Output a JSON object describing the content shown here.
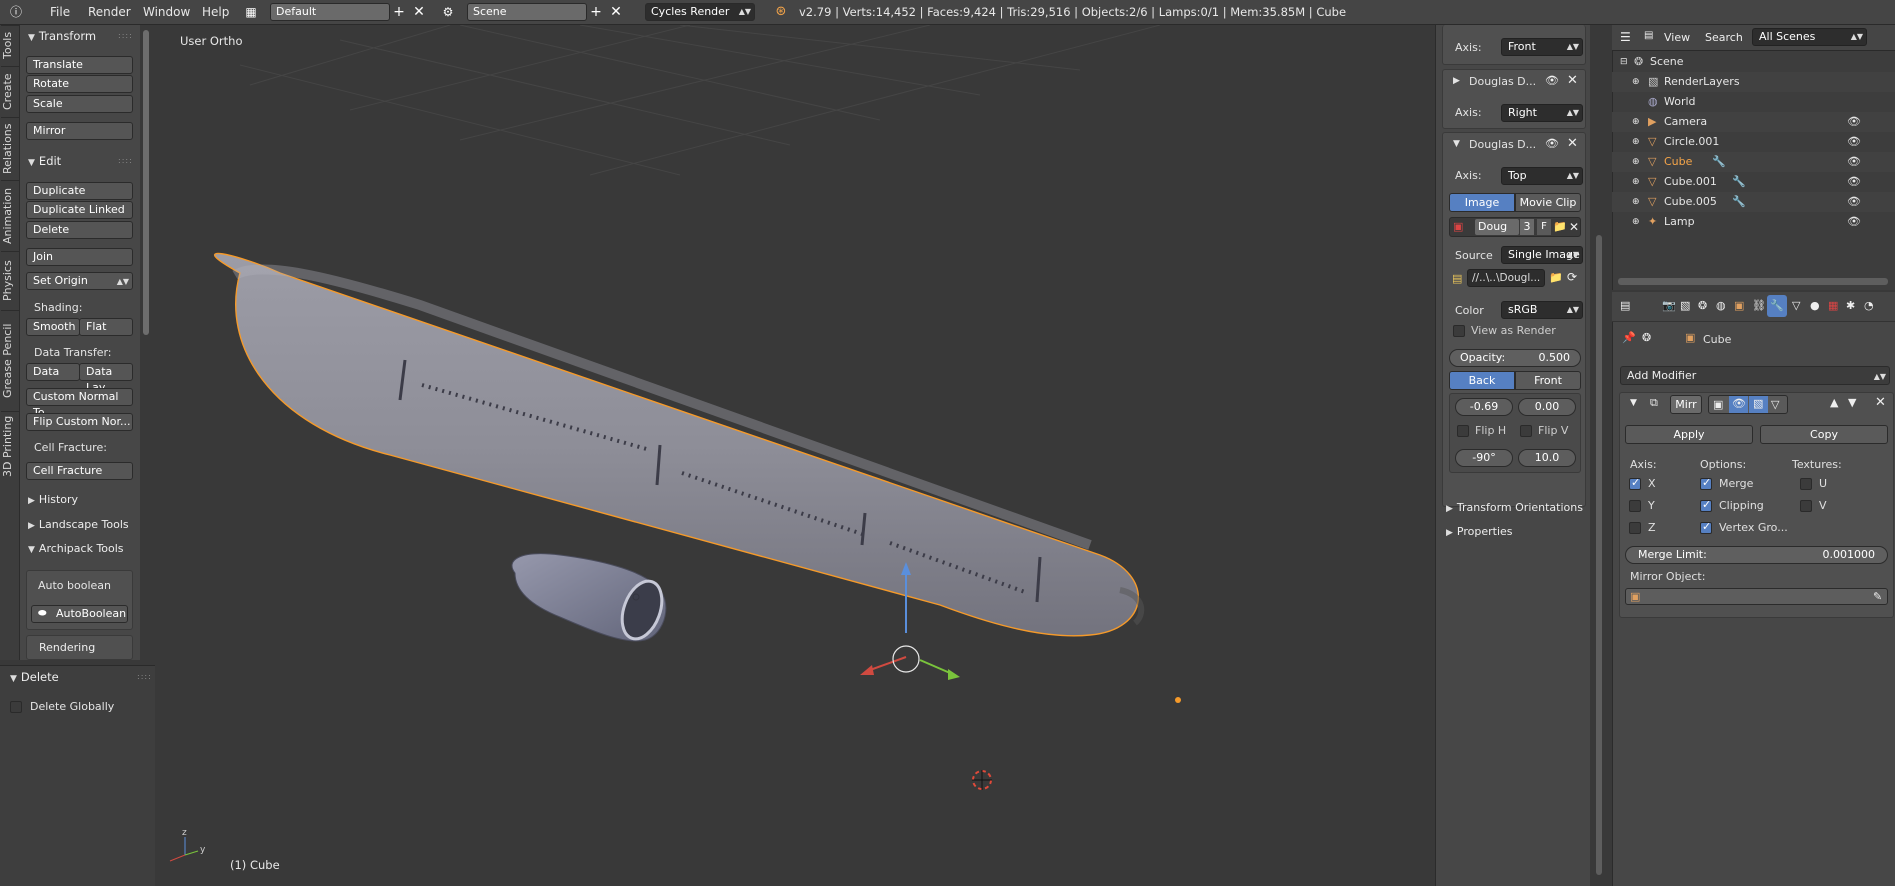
{
  "topbar": {
    "menus": [
      "File",
      "Render",
      "Window",
      "Help"
    ],
    "screen_layout": "Default",
    "scene": "Scene",
    "render_engine": "Cycles Render",
    "stats": "v2.79 | Verts:14,452 | Faces:9,424 | Tris:29,516 | Objects:2/6 | Lamps:0/1 | Mem:35.85M | Cube"
  },
  "tool_tabs": [
    "Tools",
    "Create",
    "Relations",
    "Animation",
    "Physics",
    "Grease Pencil",
    "3D Printing"
  ],
  "toolshelf": {
    "transform_title": "Transform",
    "translate": "Translate",
    "rotate": "Rotate",
    "scale": "Scale",
    "mirror": "Mirror",
    "edit_title": "Edit",
    "duplicate": "Duplicate",
    "duplicate_linked": "Duplicate Linked",
    "delete": "Delete",
    "join": "Join",
    "set_origin": "Set Origin",
    "shading_label": "Shading:",
    "smooth": "Smooth",
    "flat": "Flat",
    "data_transfer_label": "Data Transfer:",
    "data": "Data",
    "data_lay": "Data Lay",
    "custom_normal": "Custom Normal To",
    "flip_custom": "Flip Custom Nor...",
    "cell_fracture_label": "Cell Fracture:",
    "cell_fracture": "Cell Fracture",
    "history": "History",
    "landscape": "Landscape Tools",
    "archipack": "Archipack Tools",
    "auto_boolean_label": "Auto boolean",
    "auto_boolean_btn": "AutoBoolean",
    "rendering": "Rendering"
  },
  "operator_panel": {
    "title": "Delete",
    "delete_globally": "Delete Globally"
  },
  "viewport": {
    "view_label": "User Ortho",
    "object_label": "(1) Cube"
  },
  "npanel": {
    "axis_label": "Axis:",
    "img1_axis": "Front",
    "img2_name": "Douglas D...",
    "img2_axis": "Right",
    "img3_name": "Douglas D...",
    "img3_axis": "Top",
    "image_tab": "Image",
    "movie_tab": "Movie Clip",
    "image_name": "Doug",
    "users": "3",
    "fake_user": "F",
    "source_label": "Source",
    "source_value": "Single Image",
    "filepath": "//..\\..\\Dougl...",
    "color_label": "Color",
    "color_value": "sRGB",
    "view_as_render": "View as Render",
    "opacity_label": "Opacity:",
    "opacity_value": "0.500",
    "back": "Back",
    "front": "Front",
    "offset_x": "-0.69",
    "offset_y": "0.00",
    "flip_h": "Flip H",
    "flip_v": "Flip V",
    "rotation": "-90°",
    "size": "10.0",
    "transform_orientations": "Transform Orientations",
    "properties": "Properties"
  },
  "outliner": {
    "view": "View",
    "search": "Search",
    "filter": "All Scenes",
    "items": [
      {
        "name": "Scene"
      },
      {
        "name": "RenderLayers"
      },
      {
        "name": "World"
      },
      {
        "name": "Camera"
      },
      {
        "name": "Circle.001"
      },
      {
        "name": "Cube"
      },
      {
        "name": "Cube.001"
      },
      {
        "name": "Cube.005"
      },
      {
        "name": "Lamp"
      }
    ]
  },
  "properties": {
    "object_name": "Cube",
    "add_modifier": "Add Modifier",
    "modifier_name": "Mirr",
    "apply": "Apply",
    "copy": "Copy",
    "axis_label": "Axis:",
    "options_label": "Options:",
    "textures_label": "Textures:",
    "x": "X",
    "y": "Y",
    "z": "Z",
    "merge": "Merge",
    "clipping": "Clipping",
    "vertex_groups": "Vertex Gro...",
    "u": "U",
    "v": "V",
    "merge_limit_label": "Merge Limit:",
    "merge_limit_value": "0.001000",
    "mirror_object_label": "Mirror Object:"
  },
  "colors": {
    "accent": "#5680c2",
    "selection_orange": "#f59a2a",
    "active_object": "#f5a54a"
  }
}
